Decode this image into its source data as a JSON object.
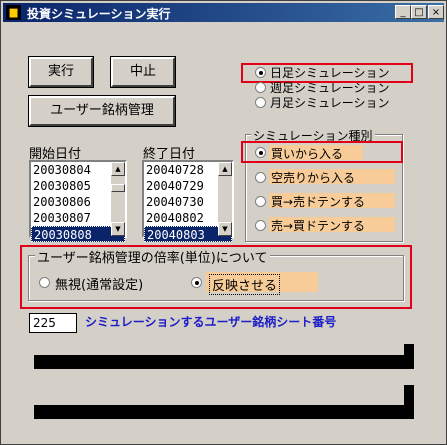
{
  "window": {
    "title": "投資シミュレーション実行",
    "title_icon": "app-icon",
    "controls": {
      "minimize": "_",
      "maximize": "□",
      "close": "×"
    }
  },
  "buttons": {
    "run": "実行",
    "stop": "中止",
    "user_stock_mgmt": "ユーザー銘柄管理"
  },
  "dates": {
    "start_label": "開始日付",
    "start_items": [
      "20030804",
      "20030805",
      "20030806",
      "20030807",
      "20030808"
    ],
    "end_label": "終了日付",
    "end_items": [
      "20040728",
      "20040729",
      "20040730",
      "20040802",
      "20040803"
    ]
  },
  "period": {
    "options": [
      "日足シミュレーション",
      "週足シミュレーション",
      "月足シミュレーション"
    ],
    "selected": 0
  },
  "sim_type": {
    "label": "シミュレーション種別",
    "options": [
      "買いから入る",
      "空売りから入る",
      "買→売ドテンする",
      "売→買ドテンする"
    ],
    "selected": 0
  },
  "multiplier": {
    "label": "ユーザー銘柄管理の倍率(単位)について",
    "options": [
      "無視(通常設定)",
      "反映させる"
    ],
    "selected": 1
  },
  "sheet": {
    "value": "225",
    "label": "シミュレーションするユーザー銘柄シート番号"
  },
  "colors": {
    "accent": "#0a246a",
    "highlight": "#e0001a",
    "option_bg": "#f7cc99",
    "sheet_label": "#1c1cc8"
  }
}
